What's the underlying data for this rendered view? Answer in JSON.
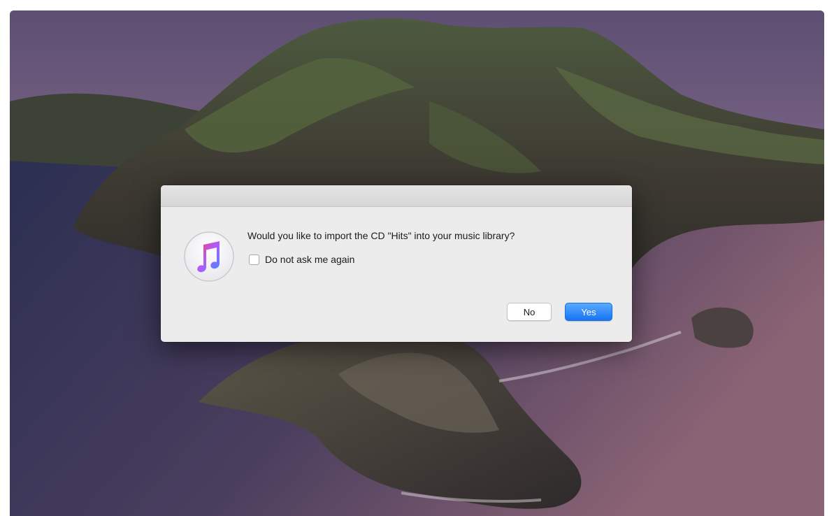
{
  "dialog": {
    "icon": "itunes-music-note-icon",
    "message": "Would you like to import the CD \"Hits\" into your music library?",
    "checkbox_label": "Do not ask me again",
    "checkbox_checked": false,
    "no_label": "No",
    "yes_label": "Yes"
  },
  "colors": {
    "accent": "#1675f4",
    "dialog_bg": "#ececec",
    "icon_pink": "#fa3e6a",
    "icon_blue": "#3f8cff",
    "icon_purple": "#b15bff"
  }
}
